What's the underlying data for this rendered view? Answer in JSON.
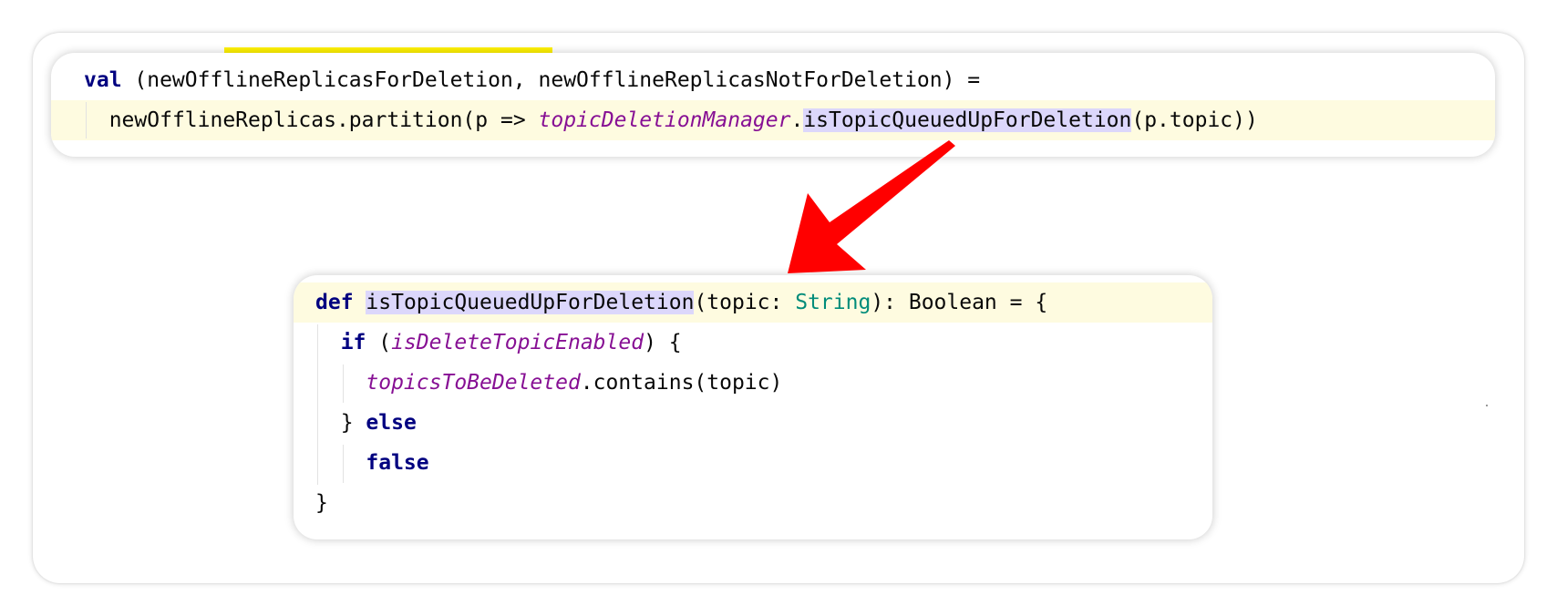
{
  "top_snippet": {
    "line1": {
      "kw_val": "val",
      "rest": " (newOfflineReplicasForDeletion, newOfflineReplicasNotForDeletion) ="
    },
    "line2": {
      "indent": "  ",
      "prefix": "newOfflineReplicas.partition(p => ",
      "field": "topicDeletionManager",
      "dot": ".",
      "method": "isTopicQueuedUpForDeletion",
      "suffix": "(p.topic))"
    }
  },
  "bottom_snippet": {
    "line1": {
      "kw_def": "def",
      "sp": " ",
      "method": "isTopicQueuedUpForDeletion",
      "params_start": "(topic: ",
      "type_string": "String",
      "params_end": "): Boolean = {"
    },
    "line2": {
      "indent": "  ",
      "kw_if": "if",
      "open": " (",
      "field": "isDeleteTopicEnabled",
      "close": ") {"
    },
    "line3": {
      "indent": "    ",
      "field": "topicsToBeDeleted",
      "rest": ".contains(topic)"
    },
    "line4": {
      "indent": "  ",
      "brace": "} ",
      "kw_else": "else"
    },
    "line5": {
      "indent": "    ",
      "kw_false": "false"
    },
    "line6": {
      "brace": "}"
    }
  },
  "colors": {
    "keyword": "#000080",
    "field": "#871094",
    "type": "#008c7a",
    "method_highlight": "#dcd7fb",
    "current_line": "#fefbe0",
    "arrow": "#ff0000"
  }
}
